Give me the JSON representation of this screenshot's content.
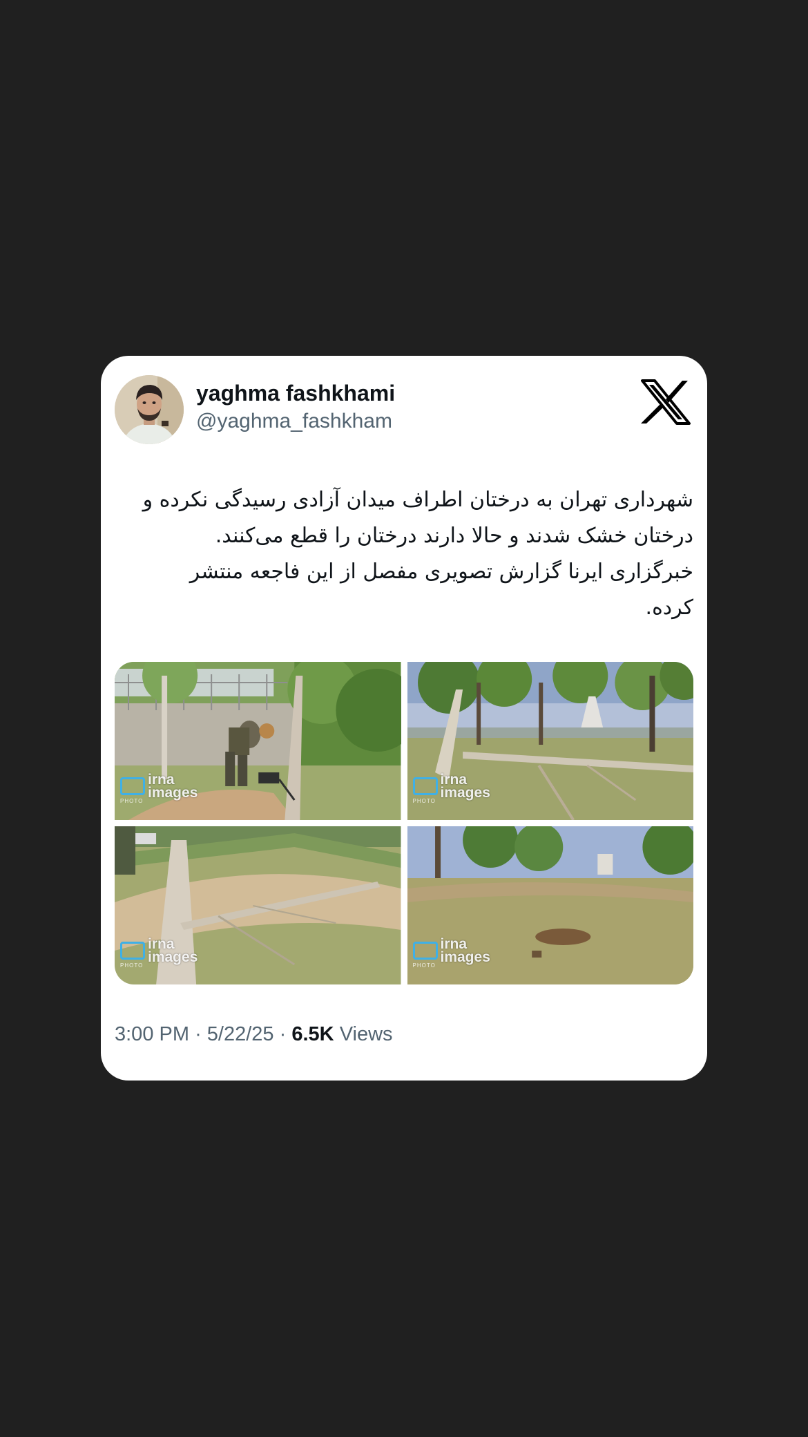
{
  "tweet": {
    "display_name": "yaghma fashkhami",
    "handle": "@yaghma_fashkham",
    "text": "شهرداری تهران به درختان اطراف میدان آزادی رسیدگی نکرده و درختان خشک شدند و حالا دارند درختان را قطع می‌کنند. خبرگزاری ایرنا گزارش تصویری مفصل از این فاجعه منتشر کرده.",
    "time": "3:00 PM",
    "separator": "·",
    "date": "5/22/25",
    "views_count": "6.5K",
    "views_label": "Views"
  },
  "media": [
    {
      "watermark": "irna\nimages",
      "watermark_sub": "PHOTO"
    },
    {
      "watermark": "irna\nimages",
      "watermark_sub": "PHOTO"
    },
    {
      "watermark": "irna\nimages",
      "watermark_sub": "PHOTO"
    },
    {
      "watermark": "irna\nimages",
      "watermark_sub": "PHOTO"
    }
  ],
  "icons": {
    "brand": "x-logo-icon",
    "avatar": "profile-avatar"
  },
  "colors": {
    "background": "#202020",
    "card": "#ffffff",
    "text_primary": "#0f1419",
    "text_secondary": "#536471",
    "watermark_accent": "#3fb0e6"
  }
}
